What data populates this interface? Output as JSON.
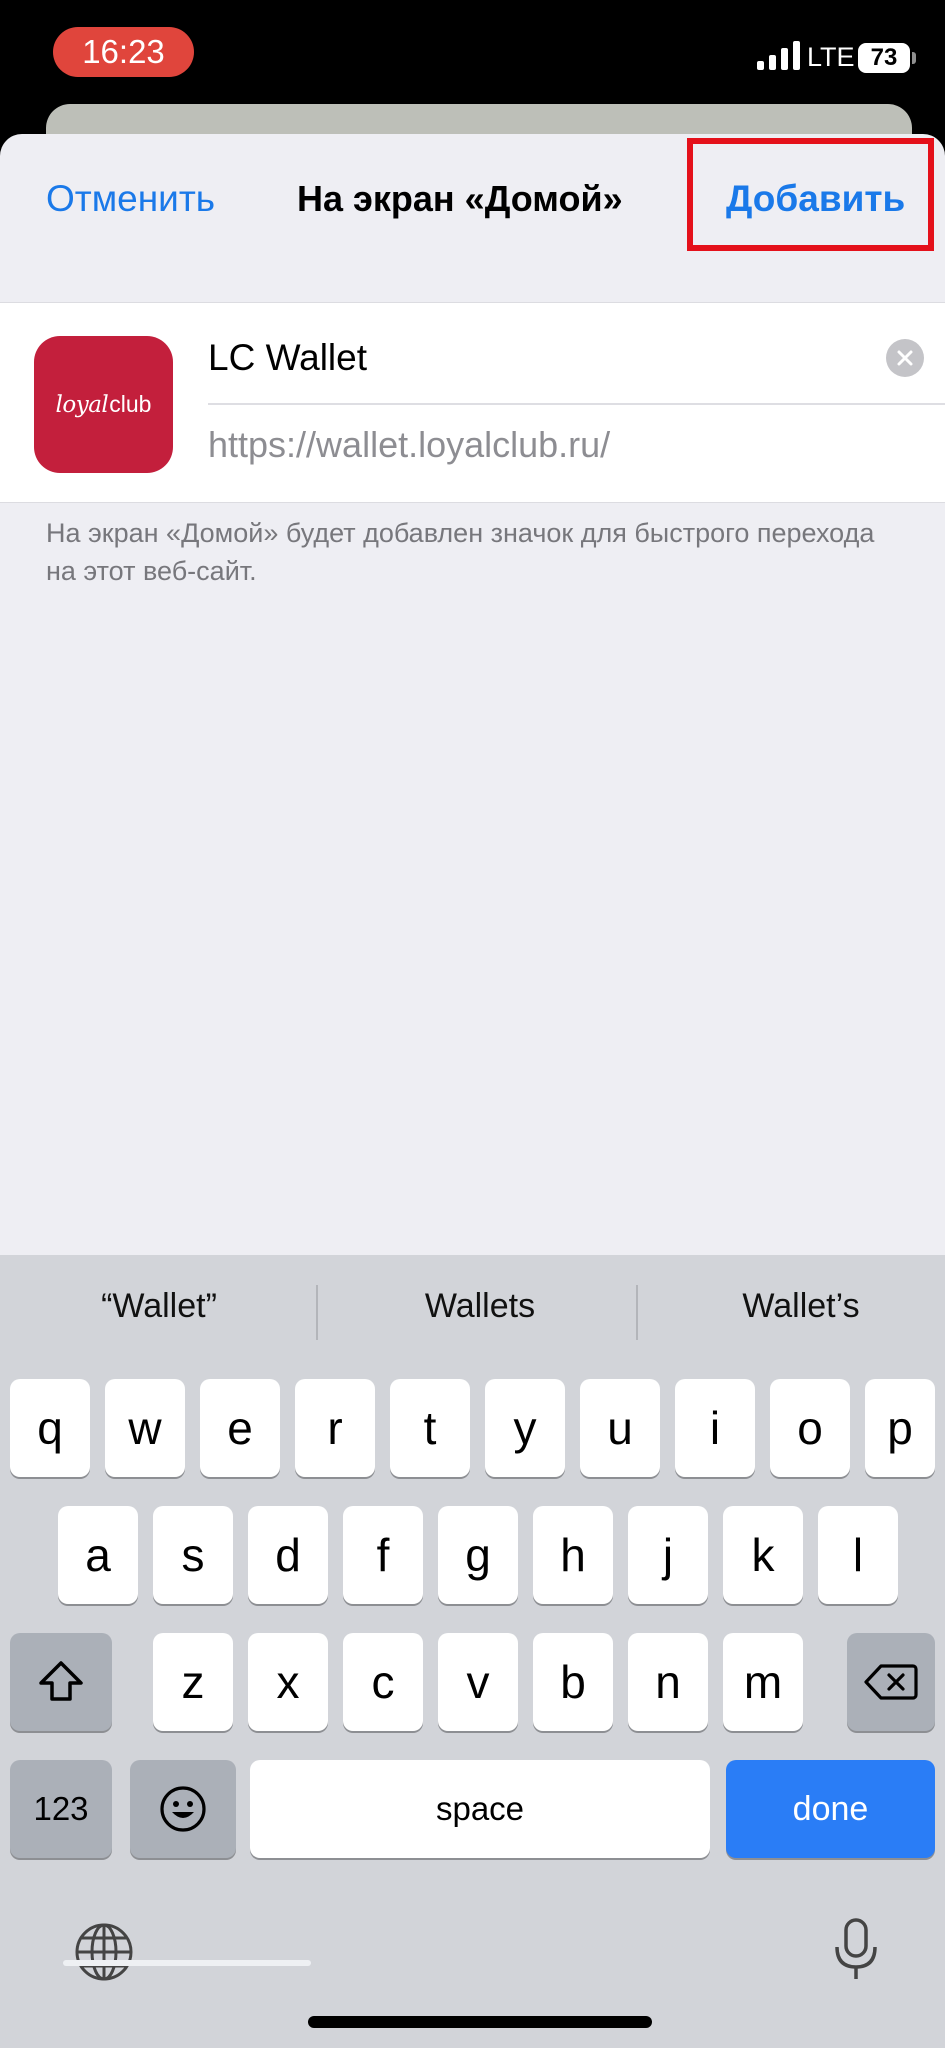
{
  "status_bar": {
    "time": "16:23",
    "network": "LTE",
    "battery": "73",
    "colors": {
      "time_pill": "#e0453c",
      "background": "#000000"
    }
  },
  "nav": {
    "cancel": "Отменить",
    "title": "На экран «Домой»",
    "add": "Добавить",
    "accent_color": "#1a79e9",
    "highlight_color": "#e4101a"
  },
  "bookmark": {
    "icon_text_script": "loyal",
    "icon_text_plain": "club",
    "icon_color": "#c31f3c",
    "name_value": "LC Wallet",
    "url": "https://wallet.loyalclub.ru/",
    "clear_icon": "clear-circle-icon"
  },
  "footnote": "На экран «Домой» будет добавлен значок для быстрого перехода на этот веб-сайт.",
  "keyboard": {
    "suggestions": [
      "“Wallet”",
      "Wallets",
      "Wallet’s"
    ],
    "row1": [
      "q",
      "w",
      "e",
      "r",
      "t",
      "y",
      "u",
      "i",
      "o",
      "p"
    ],
    "row2": [
      "a",
      "s",
      "d",
      "f",
      "g",
      "h",
      "j",
      "k",
      "l"
    ],
    "row3": [
      "z",
      "x",
      "c",
      "v",
      "b",
      "n",
      "m"
    ],
    "numbers_key": "123",
    "space_key": "space",
    "done_key": "done",
    "icons": {
      "shift": "shift-icon",
      "backspace": "backspace-icon",
      "emoji": "emoji-icon",
      "globe": "globe-icon",
      "mic": "microphone-icon"
    },
    "done_color": "#2a7df6"
  }
}
